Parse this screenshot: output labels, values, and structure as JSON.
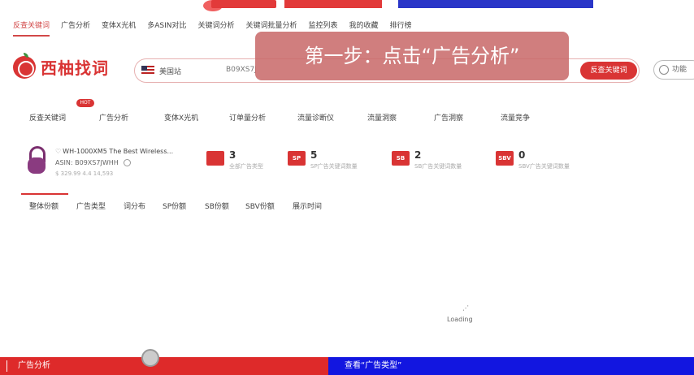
{
  "banner": {
    "colors": {
      "red": "#e23a3a",
      "blue": "#2a36c8"
    }
  },
  "tabs": [
    {
      "label": "反查关键词",
      "active": true
    },
    {
      "label": "广告分析",
      "active": false
    },
    {
      "label": "变体X光机",
      "active": false
    },
    {
      "label": "多ASIN对比",
      "active": false
    },
    {
      "label": "关键词分析",
      "active": false
    },
    {
      "label": "关键词批量分析",
      "active": false
    },
    {
      "label": "监控列表",
      "active": false
    },
    {
      "label": "我的收藏",
      "active": false
    },
    {
      "label": "排行榜",
      "active": false
    }
  ],
  "logo": {
    "text": "西柚找词"
  },
  "search": {
    "country": "美国站",
    "value": "B09XS7J",
    "button_label": "反查关键词"
  },
  "aux": {
    "label": "功能"
  },
  "tooltip": {
    "text": "第一步：点击“广告分析”"
  },
  "nav2": {
    "hot_badge": "HOT",
    "items": [
      "反查关键词",
      "广告分析",
      "变体X光机",
      "订单量分析",
      "流量诊断仪",
      "流量洞察",
      "广告洞察",
      "流量竞争"
    ]
  },
  "product": {
    "title": "WH-1000XM5 The Best Wireless...",
    "asin_label": "ASIN:",
    "asin": "B09XS7JWHH",
    "price": "$ 329.99  4.4  14,593"
  },
  "stats": [
    {
      "icon": "gift-icon",
      "icon_text": "",
      "num": "3",
      "label": "全部广告类型"
    },
    {
      "icon": "sp-icon",
      "icon_text": "SP",
      "num": "5",
      "label": "SP广告关键词数量"
    },
    {
      "icon": "sb-icon",
      "icon_text": "SB",
      "num": "2",
      "label": "SB广告关键词数量"
    },
    {
      "icon": "sbv-icon",
      "icon_text": "SBV",
      "num": "0",
      "label": "SBV广告关键词数量"
    }
  ],
  "subtabs": [
    "整体份额",
    "广告类型",
    "词分布",
    "SP份额",
    "SB份额",
    "SBV份额",
    "展示时间"
  ],
  "loading": {
    "text": "Loading"
  },
  "footer": {
    "left": "广告分析",
    "right": "查看“广告类型”"
  }
}
